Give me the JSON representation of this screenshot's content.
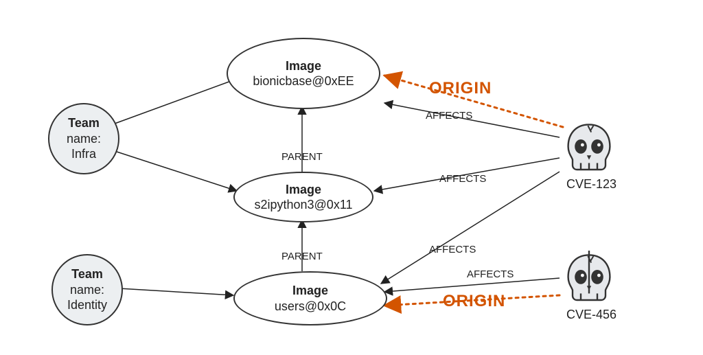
{
  "diagram": {
    "nodes": {
      "team_infra": {
        "type": "Team",
        "title": "Team",
        "line2": "name:",
        "line3": "Infra"
      },
      "team_identity": {
        "type": "Team",
        "title": "Team",
        "line2": "name:",
        "line3": "Identity"
      },
      "img_bionic": {
        "type": "Image",
        "title": "Image",
        "value": "bionicbase@0xEE"
      },
      "img_s2i": {
        "type": "Image",
        "title": "Image",
        "value": "s2ipython3@0x11"
      },
      "img_users": {
        "type": "Image",
        "title": "Image",
        "value": "users@0x0C"
      },
      "cve_123": {
        "type": "CVE",
        "label": "CVE-123"
      },
      "cve_456": {
        "type": "CVE",
        "label": "CVE-456"
      }
    },
    "edges": [
      {
        "from": "team_infra",
        "to": "img_bionic",
        "label": ""
      },
      {
        "from": "team_infra",
        "to": "img_s2i",
        "label": ""
      },
      {
        "from": "team_identity",
        "to": "img_users",
        "label": ""
      },
      {
        "from": "img_s2i",
        "to": "img_bionic",
        "label": "PARENT"
      },
      {
        "from": "img_users",
        "to": "img_s2i",
        "label": "PARENT"
      },
      {
        "from": "cve_123",
        "to": "img_bionic",
        "label": "AFFECTS"
      },
      {
        "from": "cve_123",
        "to": "img_s2i",
        "label": "AFFECTS"
      },
      {
        "from": "cve_123",
        "to": "img_users",
        "label": "AFFECTS"
      },
      {
        "from": "cve_456",
        "to": "img_users",
        "label": "AFFECTS"
      },
      {
        "from": "cve_123",
        "to": "img_bionic",
        "label": "ORIGIN",
        "style": "dotted-red"
      },
      {
        "from": "cve_456",
        "to": "img_users",
        "label": "ORIGIN",
        "style": "dotted-red"
      }
    ],
    "labels": {
      "parent": "PARENT",
      "affects": "AFFECTS",
      "origin": "ORIGIN"
    }
  }
}
